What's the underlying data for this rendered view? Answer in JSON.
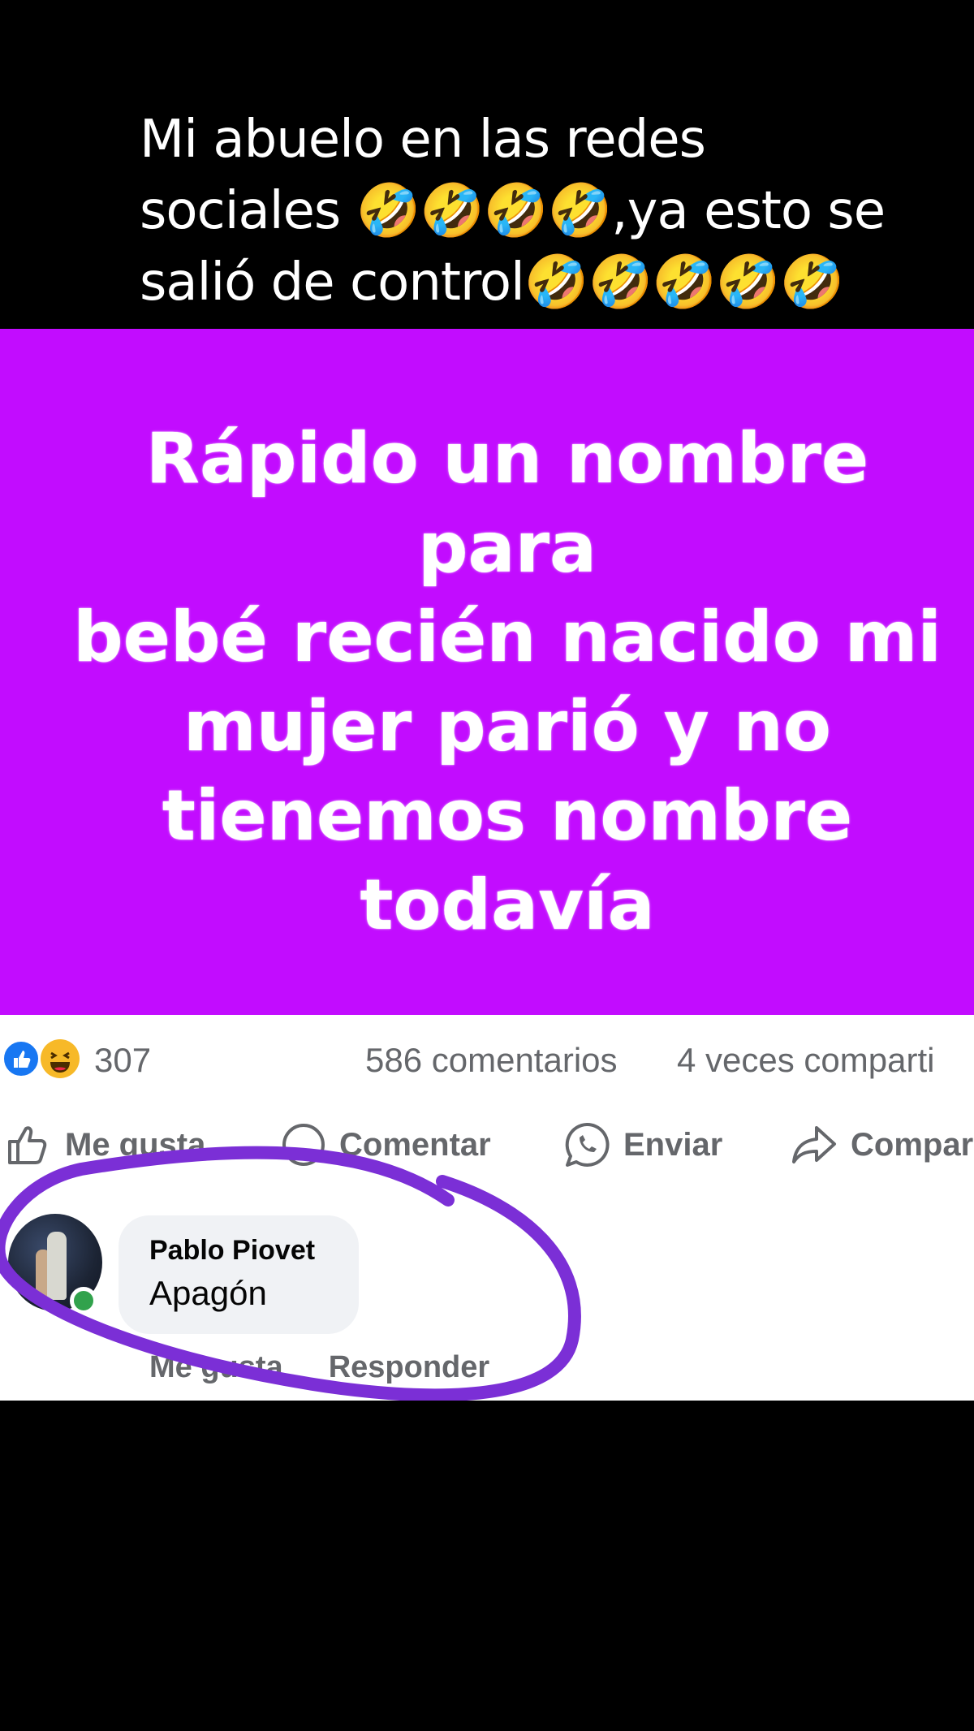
{
  "caption": {
    "line1": "Mi abuelo en las redes",
    "line2": "sociales 🤣🤣🤣🤣,ya esto se",
    "line3": "salió de control🤣🤣🤣🤣🤣"
  },
  "post": {
    "background_color": "#c20cff",
    "text_lines": [
      "Rápido un nombre para",
      "bebé recién nacido mi",
      "mujer parió y no",
      "tienemos nombre",
      "todavía"
    ]
  },
  "stats": {
    "reactions_count": "307",
    "comments": "586 comentarios",
    "shares": "4 veces comparti"
  },
  "actions": {
    "like": "Me gusta",
    "comment": "Comentar",
    "send": "Enviar",
    "share": "Compar"
  },
  "comment": {
    "author": "Pablo Piovet",
    "text": "Apagón",
    "like_label": "Me gusta",
    "reply_label": "Responder"
  },
  "colors": {
    "facebook_blue": "#1877f2",
    "annotation_purple": "#7b2fd6",
    "online_green": "#31a24c"
  }
}
